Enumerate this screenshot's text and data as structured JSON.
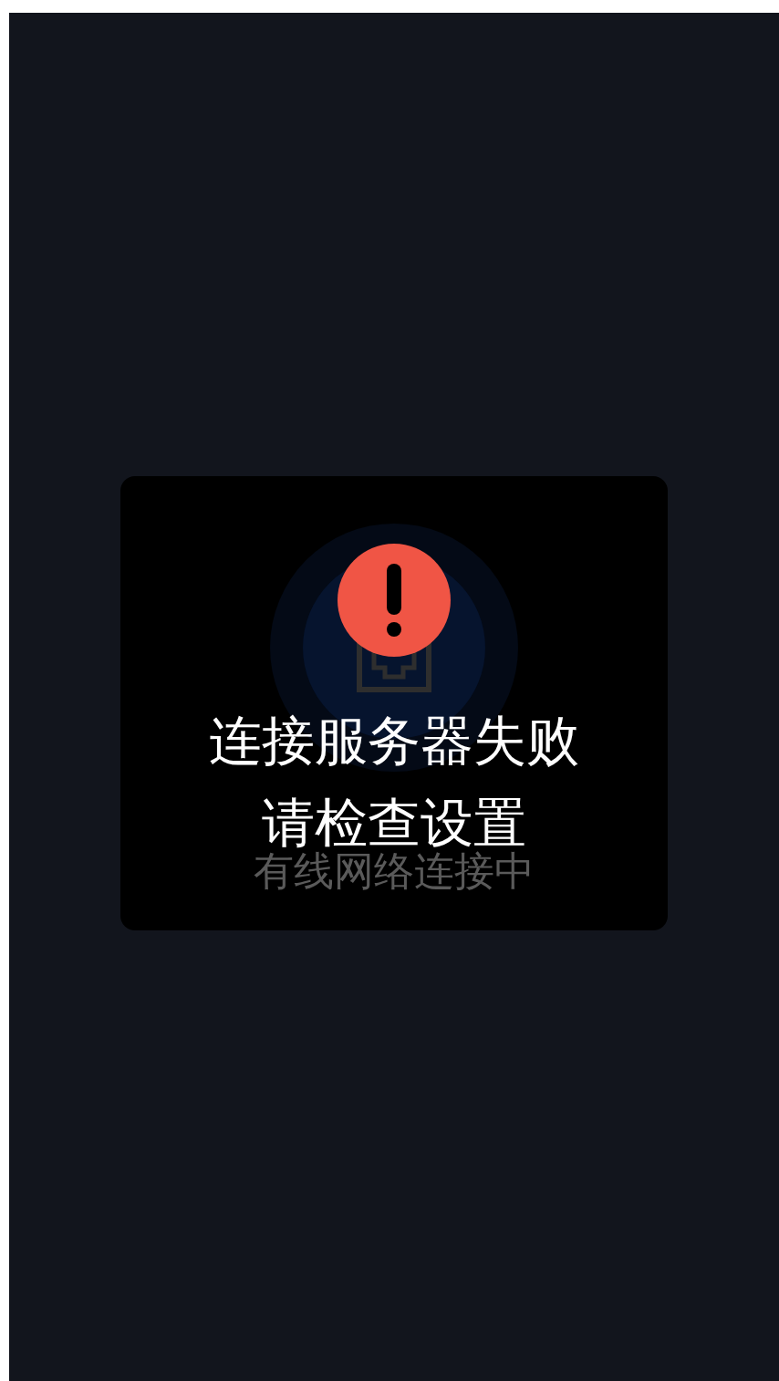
{
  "connection_card": {
    "status": "有线网络连接中"
  },
  "error_overlay": {
    "lines": [
      "连接服务器失败",
      "请检查设置"
    ]
  }
}
